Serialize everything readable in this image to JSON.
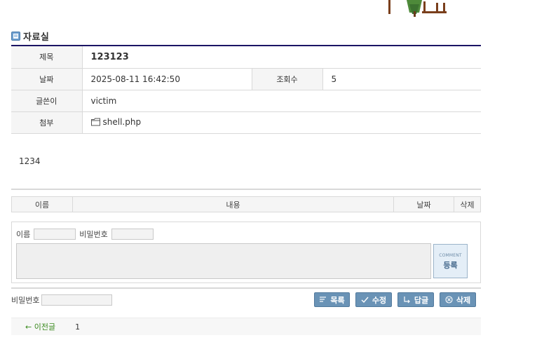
{
  "board": {
    "title": "자료실"
  },
  "post": {
    "subject_label": "제목",
    "subject": "123123",
    "date_label": "날짜",
    "date": "2025-08-11 16:42:50",
    "views_label": "조회수",
    "views": "5",
    "author_label": "글쓴이",
    "author": "victim",
    "attachment_label": "첨부",
    "attachment": "shell.php",
    "body": "1234"
  },
  "comments": {
    "headers": [
      "이름",
      "내용",
      "날짜",
      "삭제"
    ],
    "form": {
      "name_label": "이름",
      "password_label": "비밀번호",
      "submit_small": "COMMENT",
      "submit_label": "등록"
    }
  },
  "actions": {
    "password_label": "비밀번호",
    "list_label": "목록",
    "edit_label": "수정",
    "reply_label": "답글",
    "delete_label": "삭제"
  },
  "nav": {
    "prev_label": "← 이전글",
    "prev_title": "1"
  },
  "colors": {
    "title_rule": "#1b1464",
    "button": "#6a93b6",
    "prev_link": "#3a8a1e"
  }
}
